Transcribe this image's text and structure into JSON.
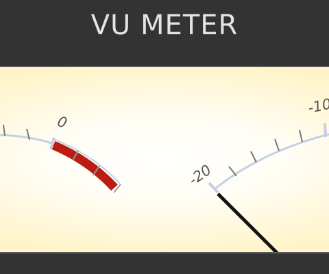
{
  "header": {
    "title": "VU METER"
  },
  "meters": [
    {
      "label": "0",
      "red_zone": true
    },
    {
      "label_left": "-20",
      "label_right": "-10",
      "needle_level": "-20"
    }
  ],
  "colors": {
    "scale": "#c5cfe3",
    "tick": "#777777",
    "red_zone": "#bb1c14",
    "needle": "#111111",
    "bezel": "#333333"
  }
}
